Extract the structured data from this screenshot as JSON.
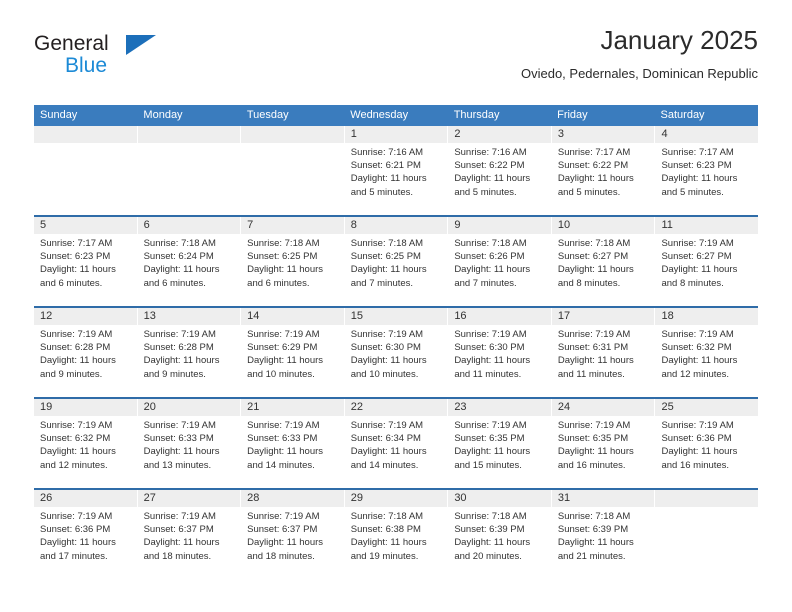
{
  "logo": {
    "word_one": "General",
    "word_two": "Blue",
    "triangle_icon": "blue-triangle-icon",
    "accent_dark": "#1c6fba",
    "accent_light": "#1c8ad6"
  },
  "header": {
    "title": "January 2025",
    "subtitle": "Oviedo, Pedernales, Dominican Republic"
  },
  "colors": {
    "header_bar": "#3a7cbe",
    "row_divider": "#2f6ca8",
    "date_band": "#eeeeee",
    "text": "#333333"
  },
  "calendar": {
    "day_headers": [
      "Sunday",
      "Monday",
      "Tuesday",
      "Wednesday",
      "Thursday",
      "Friday",
      "Saturday"
    ],
    "weeks": [
      [
        {
          "date": "",
          "sunrise": "",
          "sunset": "",
          "daylight_line1": "",
          "daylight_line2": ""
        },
        {
          "date": "",
          "sunrise": "",
          "sunset": "",
          "daylight_line1": "",
          "daylight_line2": ""
        },
        {
          "date": "",
          "sunrise": "",
          "sunset": "",
          "daylight_line1": "",
          "daylight_line2": ""
        },
        {
          "date": "1",
          "sunrise": "Sunrise: 7:16 AM",
          "sunset": "Sunset: 6:21 PM",
          "daylight_line1": "Daylight: 11 hours",
          "daylight_line2": "and 5 minutes."
        },
        {
          "date": "2",
          "sunrise": "Sunrise: 7:16 AM",
          "sunset": "Sunset: 6:22 PM",
          "daylight_line1": "Daylight: 11 hours",
          "daylight_line2": "and 5 minutes."
        },
        {
          "date": "3",
          "sunrise": "Sunrise: 7:17 AM",
          "sunset": "Sunset: 6:22 PM",
          "daylight_line1": "Daylight: 11 hours",
          "daylight_line2": "and 5 minutes."
        },
        {
          "date": "4",
          "sunrise": "Sunrise: 7:17 AM",
          "sunset": "Sunset: 6:23 PM",
          "daylight_line1": "Daylight: 11 hours",
          "daylight_line2": "and 5 minutes."
        }
      ],
      [
        {
          "date": "5",
          "sunrise": "Sunrise: 7:17 AM",
          "sunset": "Sunset: 6:23 PM",
          "daylight_line1": "Daylight: 11 hours",
          "daylight_line2": "and 6 minutes."
        },
        {
          "date": "6",
          "sunrise": "Sunrise: 7:18 AM",
          "sunset": "Sunset: 6:24 PM",
          "daylight_line1": "Daylight: 11 hours",
          "daylight_line2": "and 6 minutes."
        },
        {
          "date": "7",
          "sunrise": "Sunrise: 7:18 AM",
          "sunset": "Sunset: 6:25 PM",
          "daylight_line1": "Daylight: 11 hours",
          "daylight_line2": "and 6 minutes."
        },
        {
          "date": "8",
          "sunrise": "Sunrise: 7:18 AM",
          "sunset": "Sunset: 6:25 PM",
          "daylight_line1": "Daylight: 11 hours",
          "daylight_line2": "and 7 minutes."
        },
        {
          "date": "9",
          "sunrise": "Sunrise: 7:18 AM",
          "sunset": "Sunset: 6:26 PM",
          "daylight_line1": "Daylight: 11 hours",
          "daylight_line2": "and 7 minutes."
        },
        {
          "date": "10",
          "sunrise": "Sunrise: 7:18 AM",
          "sunset": "Sunset: 6:27 PM",
          "daylight_line1": "Daylight: 11 hours",
          "daylight_line2": "and 8 minutes."
        },
        {
          "date": "11",
          "sunrise": "Sunrise: 7:19 AM",
          "sunset": "Sunset: 6:27 PM",
          "daylight_line1": "Daylight: 11 hours",
          "daylight_line2": "and 8 minutes."
        }
      ],
      [
        {
          "date": "12",
          "sunrise": "Sunrise: 7:19 AM",
          "sunset": "Sunset: 6:28 PM",
          "daylight_line1": "Daylight: 11 hours",
          "daylight_line2": "and 9 minutes."
        },
        {
          "date": "13",
          "sunrise": "Sunrise: 7:19 AM",
          "sunset": "Sunset: 6:28 PM",
          "daylight_line1": "Daylight: 11 hours",
          "daylight_line2": "and 9 minutes."
        },
        {
          "date": "14",
          "sunrise": "Sunrise: 7:19 AM",
          "sunset": "Sunset: 6:29 PM",
          "daylight_line1": "Daylight: 11 hours",
          "daylight_line2": "and 10 minutes."
        },
        {
          "date": "15",
          "sunrise": "Sunrise: 7:19 AM",
          "sunset": "Sunset: 6:30 PM",
          "daylight_line1": "Daylight: 11 hours",
          "daylight_line2": "and 10 minutes."
        },
        {
          "date": "16",
          "sunrise": "Sunrise: 7:19 AM",
          "sunset": "Sunset: 6:30 PM",
          "daylight_line1": "Daylight: 11 hours",
          "daylight_line2": "and 11 minutes."
        },
        {
          "date": "17",
          "sunrise": "Sunrise: 7:19 AM",
          "sunset": "Sunset: 6:31 PM",
          "daylight_line1": "Daylight: 11 hours",
          "daylight_line2": "and 11 minutes."
        },
        {
          "date": "18",
          "sunrise": "Sunrise: 7:19 AM",
          "sunset": "Sunset: 6:32 PM",
          "daylight_line1": "Daylight: 11 hours",
          "daylight_line2": "and 12 minutes."
        }
      ],
      [
        {
          "date": "19",
          "sunrise": "Sunrise: 7:19 AM",
          "sunset": "Sunset: 6:32 PM",
          "daylight_line1": "Daylight: 11 hours",
          "daylight_line2": "and 12 minutes."
        },
        {
          "date": "20",
          "sunrise": "Sunrise: 7:19 AM",
          "sunset": "Sunset: 6:33 PM",
          "daylight_line1": "Daylight: 11 hours",
          "daylight_line2": "and 13 minutes."
        },
        {
          "date": "21",
          "sunrise": "Sunrise: 7:19 AM",
          "sunset": "Sunset: 6:33 PM",
          "daylight_line1": "Daylight: 11 hours",
          "daylight_line2": "and 14 minutes."
        },
        {
          "date": "22",
          "sunrise": "Sunrise: 7:19 AM",
          "sunset": "Sunset: 6:34 PM",
          "daylight_line1": "Daylight: 11 hours",
          "daylight_line2": "and 14 minutes."
        },
        {
          "date": "23",
          "sunrise": "Sunrise: 7:19 AM",
          "sunset": "Sunset: 6:35 PM",
          "daylight_line1": "Daylight: 11 hours",
          "daylight_line2": "and 15 minutes."
        },
        {
          "date": "24",
          "sunrise": "Sunrise: 7:19 AM",
          "sunset": "Sunset: 6:35 PM",
          "daylight_line1": "Daylight: 11 hours",
          "daylight_line2": "and 16 minutes."
        },
        {
          "date": "25",
          "sunrise": "Sunrise: 7:19 AM",
          "sunset": "Sunset: 6:36 PM",
          "daylight_line1": "Daylight: 11 hours",
          "daylight_line2": "and 16 minutes."
        }
      ],
      [
        {
          "date": "26",
          "sunrise": "Sunrise: 7:19 AM",
          "sunset": "Sunset: 6:36 PM",
          "daylight_line1": "Daylight: 11 hours",
          "daylight_line2": "and 17 minutes."
        },
        {
          "date": "27",
          "sunrise": "Sunrise: 7:19 AM",
          "sunset": "Sunset: 6:37 PM",
          "daylight_line1": "Daylight: 11 hours",
          "daylight_line2": "and 18 minutes."
        },
        {
          "date": "28",
          "sunrise": "Sunrise: 7:19 AM",
          "sunset": "Sunset: 6:37 PM",
          "daylight_line1": "Daylight: 11 hours",
          "daylight_line2": "and 18 minutes."
        },
        {
          "date": "29",
          "sunrise": "Sunrise: 7:18 AM",
          "sunset": "Sunset: 6:38 PM",
          "daylight_line1": "Daylight: 11 hours",
          "daylight_line2": "and 19 minutes."
        },
        {
          "date": "30",
          "sunrise": "Sunrise: 7:18 AM",
          "sunset": "Sunset: 6:39 PM",
          "daylight_line1": "Daylight: 11 hours",
          "daylight_line2": "and 20 minutes."
        },
        {
          "date": "31",
          "sunrise": "Sunrise: 7:18 AM",
          "sunset": "Sunset: 6:39 PM",
          "daylight_line1": "Daylight: 11 hours",
          "daylight_line2": "and 21 minutes."
        },
        {
          "date": "",
          "sunrise": "",
          "sunset": "",
          "daylight_line1": "",
          "daylight_line2": ""
        }
      ]
    ]
  }
}
